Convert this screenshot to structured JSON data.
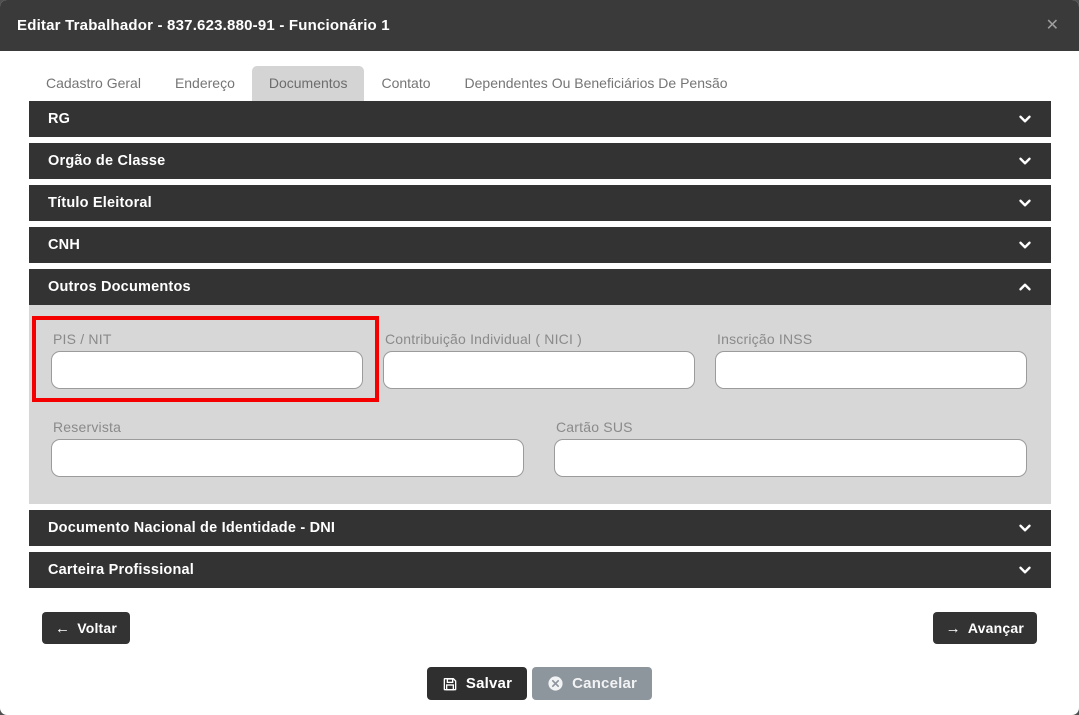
{
  "modal": {
    "title": "Editar Trabalhador - 837.623.880-91 - Funcionário 1",
    "close_icon": "✕"
  },
  "tabs": [
    {
      "label": "Cadastro Geral",
      "active": false
    },
    {
      "label": "Endereço",
      "active": false
    },
    {
      "label": "Documentos",
      "active": true
    },
    {
      "label": "Contato",
      "active": false
    },
    {
      "label": "Dependentes Ou Beneficiários De Pensão",
      "active": false
    }
  ],
  "sections": [
    {
      "label": "RG",
      "expanded": false
    },
    {
      "label": "Orgão de Classe",
      "expanded": false
    },
    {
      "label": "Título Eleitoral",
      "expanded": false
    },
    {
      "label": "CNH",
      "expanded": false
    },
    {
      "label": "Outros Documentos",
      "expanded": true
    },
    {
      "label": "Documento Nacional de Identidade - DNI",
      "expanded": false
    },
    {
      "label": "Carteira Profissional",
      "expanded": false
    }
  ],
  "outros_documentos": {
    "fields": {
      "pis_nit": {
        "label": "PIS / NIT",
        "value": "",
        "highlighted": true
      },
      "contribuicao_individual": {
        "label": "Contribuição Individual ( NICI )",
        "value": ""
      },
      "inscricao_inss": {
        "label": "Inscrição INSS",
        "value": ""
      },
      "reservista": {
        "label": "Reservista",
        "value": ""
      },
      "cartao_sus": {
        "label": "Cartão SUS",
        "value": ""
      }
    }
  },
  "buttons": {
    "voltar": "Voltar",
    "avancar": "Avançar",
    "salvar": "Salvar",
    "cancelar": "Cancelar",
    "voltar_icon": "←",
    "avancar_icon": "→"
  },
  "icons": {
    "close": "x-icon",
    "collapsed": "chevron-down-icon",
    "expanded": "chevron-up-icon",
    "salvar": "floppy-disk-icon",
    "cancelar": "circle-x-icon"
  },
  "colors": {
    "header_bg": "#3a3a3a",
    "accordion_bg": "#333333",
    "panel_bg": "#d7d7d7",
    "active_tab_bg": "#d4d4d4",
    "cancel_bg": "#8d959d",
    "highlight_red": "#f40000"
  }
}
